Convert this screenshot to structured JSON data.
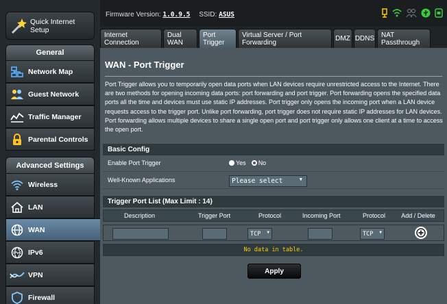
{
  "colors": {
    "accent": "#ffcc00",
    "active_tab": "#5a6a74",
    "panel": "#4d595e",
    "wifi": "#3bcc3b"
  },
  "sidebar": {
    "qis_label": "Quick Internet Setup",
    "general_header": "General",
    "general_items": [
      {
        "label": "Network Map",
        "icon": "network-map-icon"
      },
      {
        "label": "Guest Network",
        "icon": "guest-network-icon"
      },
      {
        "label": "Traffic Manager",
        "icon": "traffic-manager-icon"
      },
      {
        "label": "Parental Controls",
        "icon": "lock-icon"
      }
    ],
    "advanced_header": "Advanced Settings",
    "advanced_items": [
      {
        "label": "Wireless",
        "icon": "wifi-icon"
      },
      {
        "label": "LAN",
        "icon": "home-icon"
      },
      {
        "label": "WAN",
        "icon": "globe-icon"
      },
      {
        "label": "IPv6",
        "icon": "ipv6-icon"
      },
      {
        "label": "VPN",
        "icon": "vpn-icon"
      },
      {
        "label": "Firewall",
        "icon": "firewall-icon"
      }
    ]
  },
  "topbar": {
    "fw_label": "Firmware Version:",
    "fw_value": "1.0.9.5",
    "ssid_label": "SSID:",
    "ssid_value": "ASUS"
  },
  "tabs": [
    {
      "label": "Internet Connection"
    },
    {
      "label": "Dual WAN"
    },
    {
      "label": "Port Trigger"
    },
    {
      "label": "Virtual Server / Port Forwarding"
    },
    {
      "label": "DMZ"
    },
    {
      "label": "DDNS"
    },
    {
      "label": "NAT Passthrough"
    }
  ],
  "page": {
    "title": "WAN - Port Trigger",
    "description": "Port Trigger allows you to temporarily open data ports when LAN devices require unrestricted access to the Internet. There are two methods for opening incoming data ports: port forwarding and port trigger. Port forwarding opens the specified data ports all the time and devices must use static IP addresses. Port trigger only opens the incoming port when a LAN device requests access to the trigger port. Unlike port forwarding, port trigger does not require static IP addresses for LAN devices. Port forwarding allows multiple devices to share a single open port and port trigger only allows one client at a time to access the open port."
  },
  "basic": {
    "header": "Basic Config",
    "enable_label": "Enable Port Trigger",
    "yes": "Yes",
    "no": "No",
    "wellknown_label": "Well-Known Applications",
    "wellknown_value": "Please select"
  },
  "list": {
    "header": "Trigger Port List (Max Limit : 14)",
    "cols": [
      "Description",
      "Trigger Port",
      "Protocol",
      "Incoming Port",
      "Protocol",
      "Add / Delete"
    ],
    "protocol1": "TCP",
    "protocol2": "TCP",
    "nodata": "No data in table."
  },
  "apply_label": "Apply"
}
